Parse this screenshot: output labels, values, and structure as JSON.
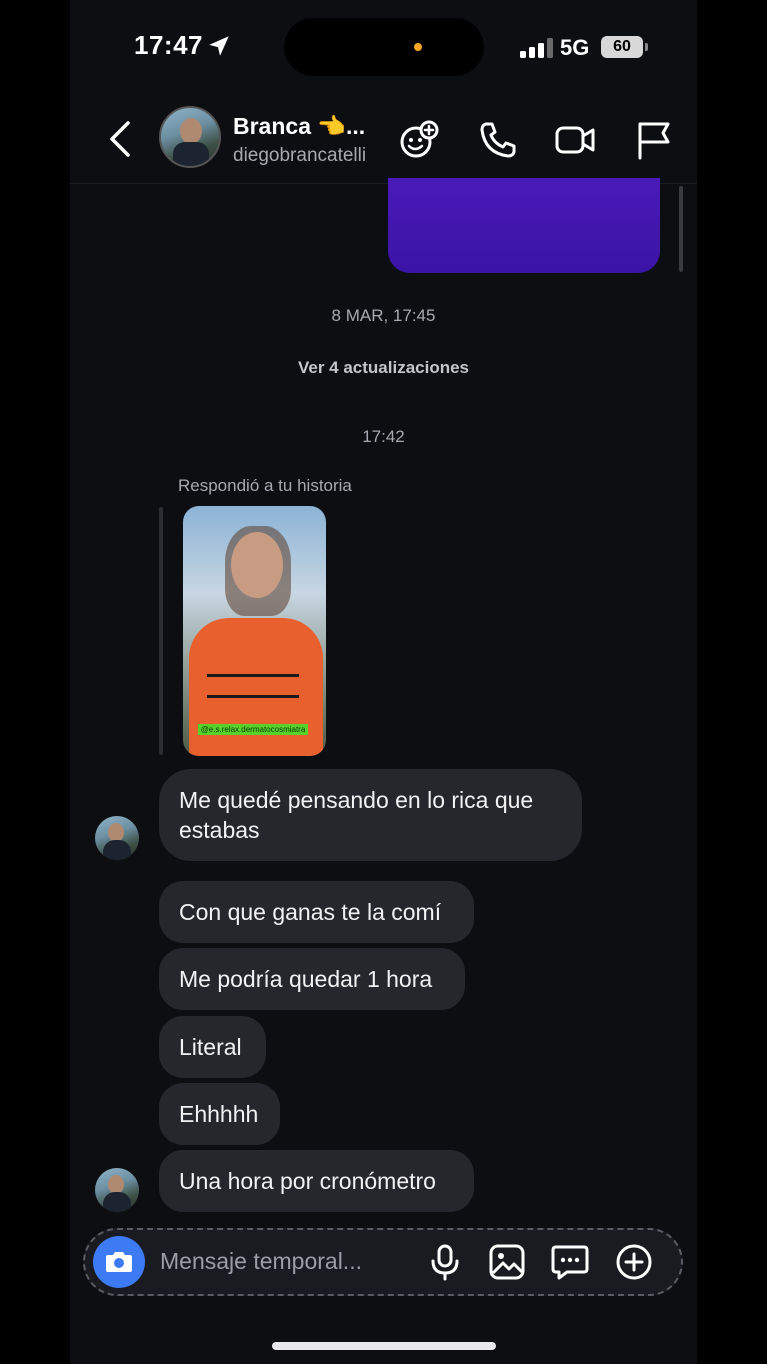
{
  "status_bar": {
    "time": "17:47",
    "network": "5G",
    "battery": "60"
  },
  "header": {
    "name": "Branca 👈...",
    "username": "diegobrancatelli"
  },
  "conversation": {
    "timestamp_1": "8 MAR, 17:45",
    "updates_link": "Ver 4 actualizaciones",
    "timestamp_2": "17:42",
    "reply_label": "Respondió a tu historia",
    "story_tag": "@e.s.relax.dermatocosmiatra",
    "messages": [
      "Me quedé pensando en lo rica que estabas",
      "Con que ganas te la comí",
      "Me podría quedar 1 hora",
      "Literal",
      "Ehhhhh",
      "Una hora por cronómetro"
    ]
  },
  "composer": {
    "placeholder": "Mensaje temporal..."
  },
  "colors": {
    "sent_bubble": "#3a14a5",
    "received_bubble": "#26272c",
    "camera_button": "#3d7bf5",
    "background": "#0d0e12"
  }
}
